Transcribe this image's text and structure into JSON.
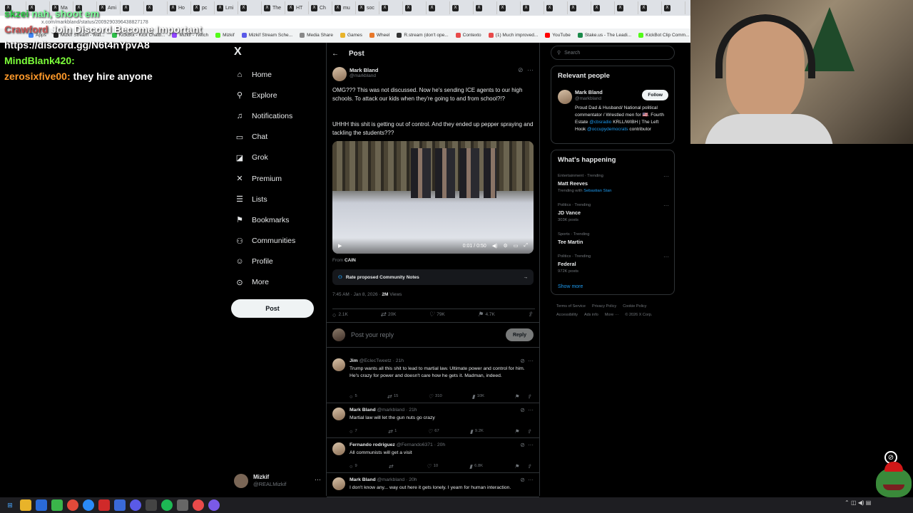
{
  "browser": {
    "tabs": [
      "",
      "",
      "Ma",
      "",
      "Ami",
      "",
      "",
      "Ho",
      "pc",
      "Lmi",
      "",
      "The",
      "HT",
      "Ch",
      "mu",
      "soc",
      "",
      "",
      "",
      "",
      "",
      "",
      "",
      "",
      "",
      "",
      "",
      "",
      ""
    ],
    "url": "x.com/markbland/status/2009290396438827178",
    "bookmarks": [
      "Apps",
      "Mizkif Stream - Wat...",
      "KickBot - Kick Chatb...",
      "Mizkif - Twitch",
      "Mizkif",
      "Mizkif Stream Sche...",
      "Media Share",
      "Games",
      "Wheel",
      "R.stream (don't ope...",
      "Contexto",
      "(1) Much improved...",
      "YouTube",
      "Stake.us - The Leadi...",
      "KickBot Clip Comm...",
      "Kickaway - Kick Giv..."
    ]
  },
  "chat": [
    {
      "user": "skzei",
      "text": "nah, shoot em",
      "user_color": "#2fd04a",
      "text_color": "#7dff9a"
    },
    {
      "user": "Crawford",
      "text": "Join Discord Become Important",
      "user_color": "#d05a5a",
      "text_color": "#ffffff"
    },
    {
      "user": "",
      "text": "https://discord.gg/N6t4nYpvA8",
      "user_color": "#ffffff",
      "text_color": "#ffffff"
    },
    {
      "user": "MindBlank420:",
      "text": "",
      "user_color": "#7dff3a",
      "text_color": "#ffffff"
    },
    {
      "user": "zerosixfive00:",
      "text": "they hire anyone",
      "user_color": "#ff9a2a",
      "text_color": "#ffffff"
    }
  ],
  "nav": {
    "logo": "X",
    "items": [
      {
        "label": "Home",
        "icon": "home-icon",
        "glyph": "⌂"
      },
      {
        "label": "Explore",
        "icon": "search-icon",
        "glyph": "⚲"
      },
      {
        "label": "Notifications",
        "icon": "bell-icon",
        "glyph": "♫"
      },
      {
        "label": "Chat",
        "icon": "chat-icon",
        "glyph": "▭"
      },
      {
        "label": "Grok",
        "icon": "grok-icon",
        "glyph": "◪"
      },
      {
        "label": "Premium",
        "icon": "x-premium-icon",
        "glyph": "✕"
      },
      {
        "label": "Lists",
        "icon": "list-icon",
        "glyph": "☰"
      },
      {
        "label": "Bookmarks",
        "icon": "bookmark-icon",
        "glyph": "⚑"
      },
      {
        "label": "Communities",
        "icon": "communities-icon",
        "glyph": "⚇"
      },
      {
        "label": "Profile",
        "icon": "person-icon",
        "glyph": "☺"
      },
      {
        "label": "More",
        "icon": "more-circle-icon",
        "glyph": "⊙"
      }
    ],
    "post_button": "Post",
    "account": {
      "name": "Mizkif",
      "handle": "@REALMizkif"
    }
  },
  "main": {
    "header": "Post",
    "post": {
      "author": "Mark Bland",
      "handle": "@markbland",
      "text1": "OMG??? This was not discussed. Now he's sending ICE agents to our high schools. To attack our kids when they're going to and from school?!?",
      "text2": "UHHH this shit is getting out of control. And they ended up pepper spraying and tackling the students???",
      "video_time": "0:01 / 0:50",
      "from_label": "From",
      "from_source": "CAIN",
      "notes_label": "Rate proposed Community Notes",
      "timestamp": "7:45 AM · Jan 8, 2026 · ",
      "views": "2M",
      "views_label": " Views",
      "replies": "2.1K",
      "reposts": "20K",
      "likes": "79K",
      "bookmarks": "4.7K"
    },
    "reply_placeholder": "Post your reply",
    "reply_button": "Reply",
    "replies": [
      {
        "name": "Jim",
        "handle": "@EclecTweetz · 21h",
        "text": "Trump wants all this shit to lead to martial law.  Ultimate power and control for him.  He's crazy for power and doesn't care how he gets it.  Madman, indeed.",
        "replies": "5",
        "reposts": "15",
        "likes": "310",
        "views": "10K"
      },
      {
        "name": "Mark Bland",
        "handle": "@markbland · 21h",
        "text": "Martial law will let the gun nuts go crazy",
        "replies": "7",
        "reposts": "1",
        "likes": "67",
        "views": "9.2K"
      },
      {
        "name": "Fernando rodriguez",
        "handle": "@Fernando6371 · 20h",
        "text": "All communists will get a visit",
        "replies": "9",
        "reposts": "",
        "likes": "10",
        "views": "6.8K"
      },
      {
        "name": "Mark Bland",
        "handle": "@markbland · 20h",
        "text": "I don't know any... way out here it gets lonely. I yearn for human interaction.",
        "replies": "",
        "reposts": "",
        "likes": "",
        "views": ""
      }
    ]
  },
  "right": {
    "search_placeholder": "Search",
    "relevant_title": "Relevant people",
    "person": {
      "name": "Mark Bland",
      "handle": "@markbland",
      "follow": "Follow",
      "bio_1": "Proud Dad & Husband/ National political commentator / Wrestled men for 🇺🇸. Fourth Estate ",
      "bio_link1": "@cbsradio",
      "bio_2": " KRLL/WIBH | The Left Hook ",
      "bio_link2": "@occupydemocrats",
      "bio_3": " contributor"
    },
    "happening_title": "What's happening",
    "trends": [
      {
        "context": "Entertainment · Trending",
        "name": "Matt Reeves",
        "sub": "Trending with ",
        "sub_link": "Sebastian Stan"
      },
      {
        "context": "Politics · Trending",
        "name": "JD Vance",
        "sub": "303K posts",
        "sub_link": ""
      },
      {
        "context": "Sports · Trending",
        "name": "Tee Martin",
        "sub": "",
        "sub_link": ""
      },
      {
        "context": "Politics · Trending",
        "name": "Federal",
        "sub": "972K posts",
        "sub_link": ""
      }
    ],
    "show_more": "Show more",
    "footer": [
      "Terms of Service",
      "Privacy Policy",
      "Cookie Policy",
      "Accessibility",
      "Ads info",
      "More ···",
      "© 2026 X Corp."
    ]
  },
  "colors": {
    "accent": "#1d9bf0",
    "background": "#000000",
    "border": "#2f3336",
    "muted": "#71767b"
  }
}
